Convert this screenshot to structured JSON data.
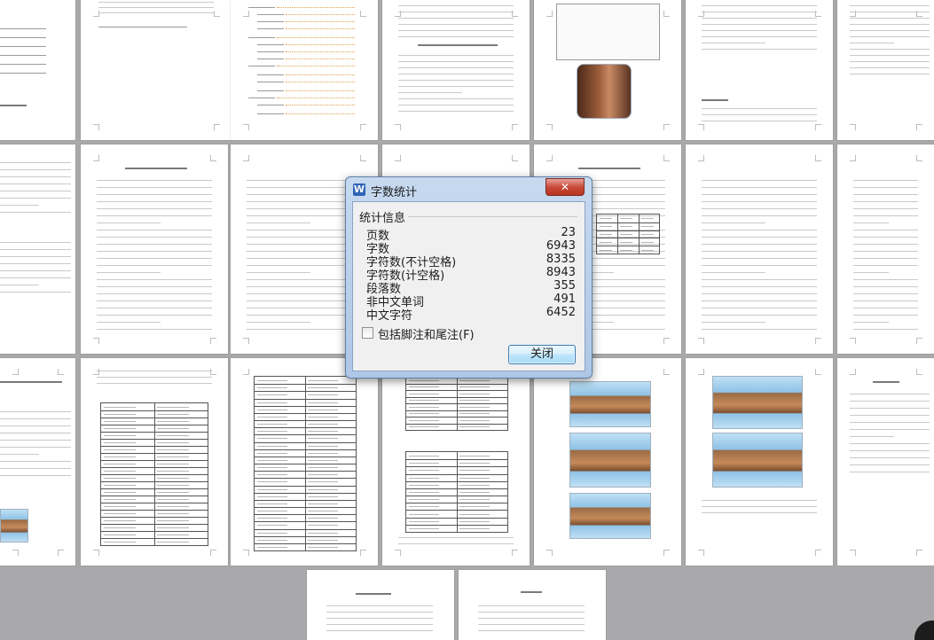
{
  "dialog": {
    "title": "字数统计",
    "app_icon": "W",
    "close_glyph": "✕",
    "group_label": "统计信息",
    "stats": [
      {
        "label": "页数",
        "value": "23"
      },
      {
        "label": "字数",
        "value": "6943"
      },
      {
        "label": "字符数(不计空格)",
        "value": "8335"
      },
      {
        "label": "字符数(计空格)",
        "value": "8943"
      },
      {
        "label": "段落数",
        "value": "355"
      },
      {
        "label": "非中文单词",
        "value": "491"
      },
      {
        "label": "中文字符",
        "value": "6452"
      }
    ],
    "checkbox_label": "包括脚注和尾注(F)",
    "checkbox_checked": false,
    "close_button_label": "关闭"
  },
  "colors": {
    "workspace": "#a9a9ab",
    "page": "#ffffff",
    "dialog_frame": "#aec7e6",
    "close_red": "#c94b3c",
    "toc_orange": "#e0a24a"
  }
}
